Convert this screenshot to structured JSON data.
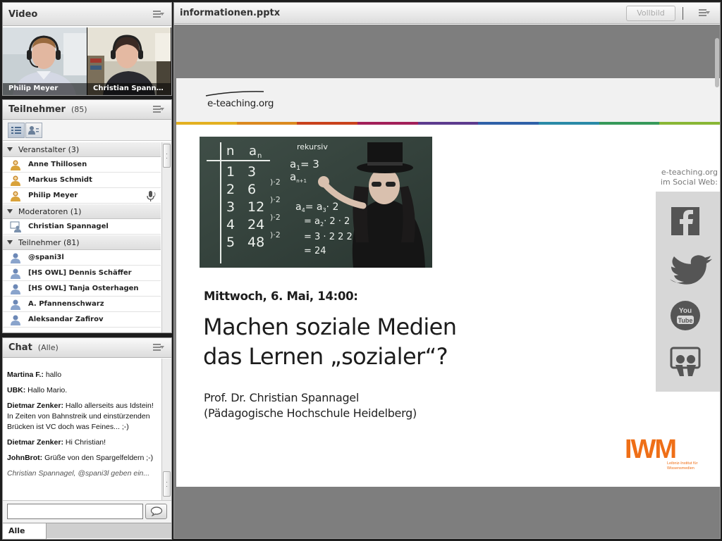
{
  "video": {
    "title": "Video",
    "cams": [
      {
        "name": "Philip Meyer"
      },
      {
        "name": "Christian Spanna..."
      }
    ]
  },
  "attendees": {
    "title": "Teilnehmer",
    "count": "(85)",
    "groups": [
      {
        "label": "Veranstalter (3)",
        "members": [
          "Anne Thillosen",
          "Markus Schmidt",
          "Philip Meyer"
        ]
      },
      {
        "label": "Moderatoren (1)",
        "members": [
          "Christian Spannagel"
        ]
      },
      {
        "label": "Teilnehmer (81)",
        "members": [
          "@spani3l",
          "[HS OWL] Dennis Schäffer",
          "[HS OWL] Tanja Osterhagen",
          "A. Pfannenschwarz",
          "Aleksandar Zafirov"
        ]
      }
    ]
  },
  "chat": {
    "title": "Chat",
    "scope": "(Alle)",
    "messages": [
      {
        "author": "Martina F.:",
        "text": "hallo"
      },
      {
        "author": "UBK:",
        "text": "Hallo Mario."
      },
      {
        "author": "Dietmar Zenker:",
        "text": "Hallo allerseits aus Idstein! In Zeiten von Bahnstreik und einstürzenden Brücken ist VC  doch was Feines... ;-)"
      },
      {
        "author": "Dietmar Zenker:",
        "text": "Hi Christian!"
      },
      {
        "author": "JohnBrot:",
        "text": "Grüße von den Spargelfeldern ;-)"
      }
    ],
    "typing": "Christian Spannagel, @spani3l geben ein...",
    "input_value": "",
    "tab": "Alle"
  },
  "share": {
    "title": "informationen.pptx",
    "fullscreen_label": "Vollbild"
  },
  "slide": {
    "logo": "e-teaching.org",
    "date": "Mittwoch, 6. Mai, 14:00:",
    "title_line1": "Machen soziale Medien",
    "title_line2": "das Lernen „sozialer“?",
    "speaker_line1": "Prof. Dr. Christian Spannagel",
    "speaker_line2": "(Pädagogische Hochschule Heidelberg)",
    "social_line1": "e-teaching.org",
    "social_line2": "im Social Web:",
    "iwm_logo": "IWM",
    "iwm_sub1": "Leibniz-Institut für",
    "iwm_sub2": "Wissensmedien",
    "board_header_n": "n",
    "board_header_a": "a",
    "board_header_sub": "n",
    "board_label": "rekursiv",
    "board_rows": [
      {
        "n": "1",
        "a": "3"
      },
      {
        "n": "2",
        "a": "6"
      },
      {
        "n": "3",
        "a": "12"
      },
      {
        "n": "4",
        "a": "24"
      },
      {
        "n": "5",
        "a": "48"
      }
    ],
    "board_ratio": "·2",
    "board_formula1": "a",
    "board_formula1_sub": "1",
    "board_formula1_rhs": "= 3",
    "board_formula2": "a",
    "board_formula2_sub": "n+1",
    "board_formula3": "a",
    "board_formula3_sub": "4",
    "board_formula3_rhs": "= a",
    "board_formula3_rhs_sub": "3",
    "board_formula3_rhs_tail": "· 2",
    "board_formula4": "= a",
    "board_formula4_sub": "2",
    "board_formula4_tail": "· 2 · 2",
    "board_formula5": "= 3 · 2 2 2",
    "board_formula6": "= 24"
  },
  "colors": {
    "bar": [
      "#e3b021",
      "#db8a1f",
      "#c9421c",
      "#a2205a",
      "#5d3b8e",
      "#2f61a8",
      "#2a8aa7",
      "#36995a",
      "#89b735"
    ],
    "iwm_orange": "#ef6f17"
  },
  "icons": {
    "social": [
      "facebook-icon",
      "twitter-icon",
      "youtube-icon",
      "slideshare-icon"
    ]
  }
}
